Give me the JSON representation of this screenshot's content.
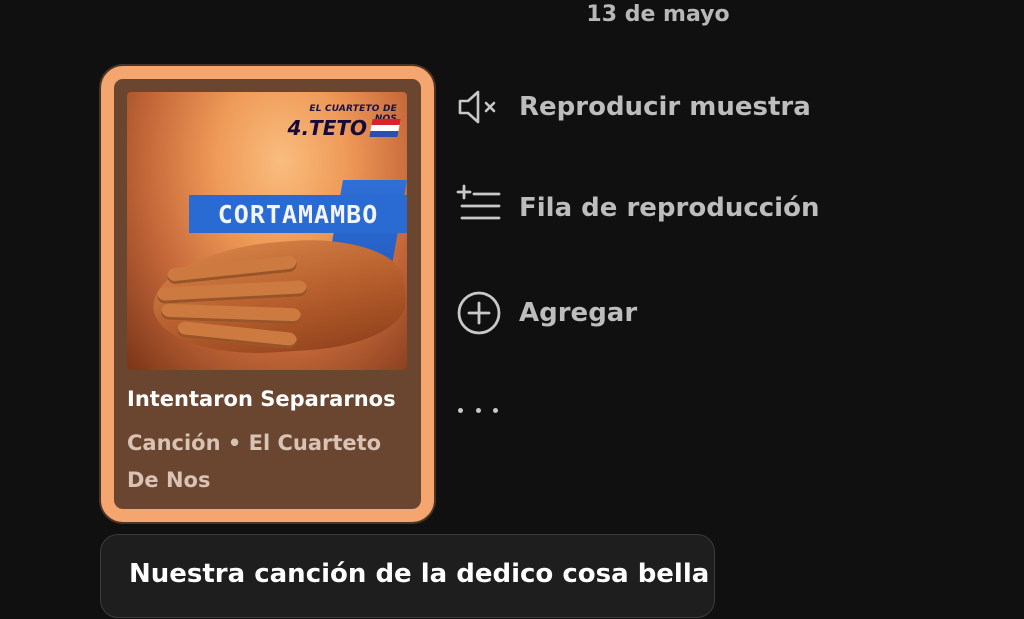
{
  "header": {
    "date": "13 de mayo"
  },
  "shared_card": {
    "cover": {
      "band_name": "EL CUARTETO DE NOS",
      "album_name": "4.TETO",
      "cover_title": "CORTAMAMBO"
    },
    "song_title": "Intentaron Separarnos",
    "song_subtitle": "Canción • El Cuarteto De Nos"
  },
  "actions": [
    {
      "label": "Reproducir muestra",
      "icon": "speaker-muted-icon"
    },
    {
      "label": "Fila de reproducción",
      "icon": "add-to-queue-icon"
    },
    {
      "label": "Agregar",
      "icon": "plus-circle-icon"
    }
  ],
  "more_menu": {
    "icon": "more-horizontal-icon"
  },
  "message": {
    "text": "Nuestra canción de la dedico cosa bella"
  },
  "colors": {
    "background": "#101010",
    "card_border": "#f5a56e",
    "card_fill": "#6a4530",
    "action_text": "#bdbdbd",
    "message_bubble": "#1e1e1e"
  }
}
